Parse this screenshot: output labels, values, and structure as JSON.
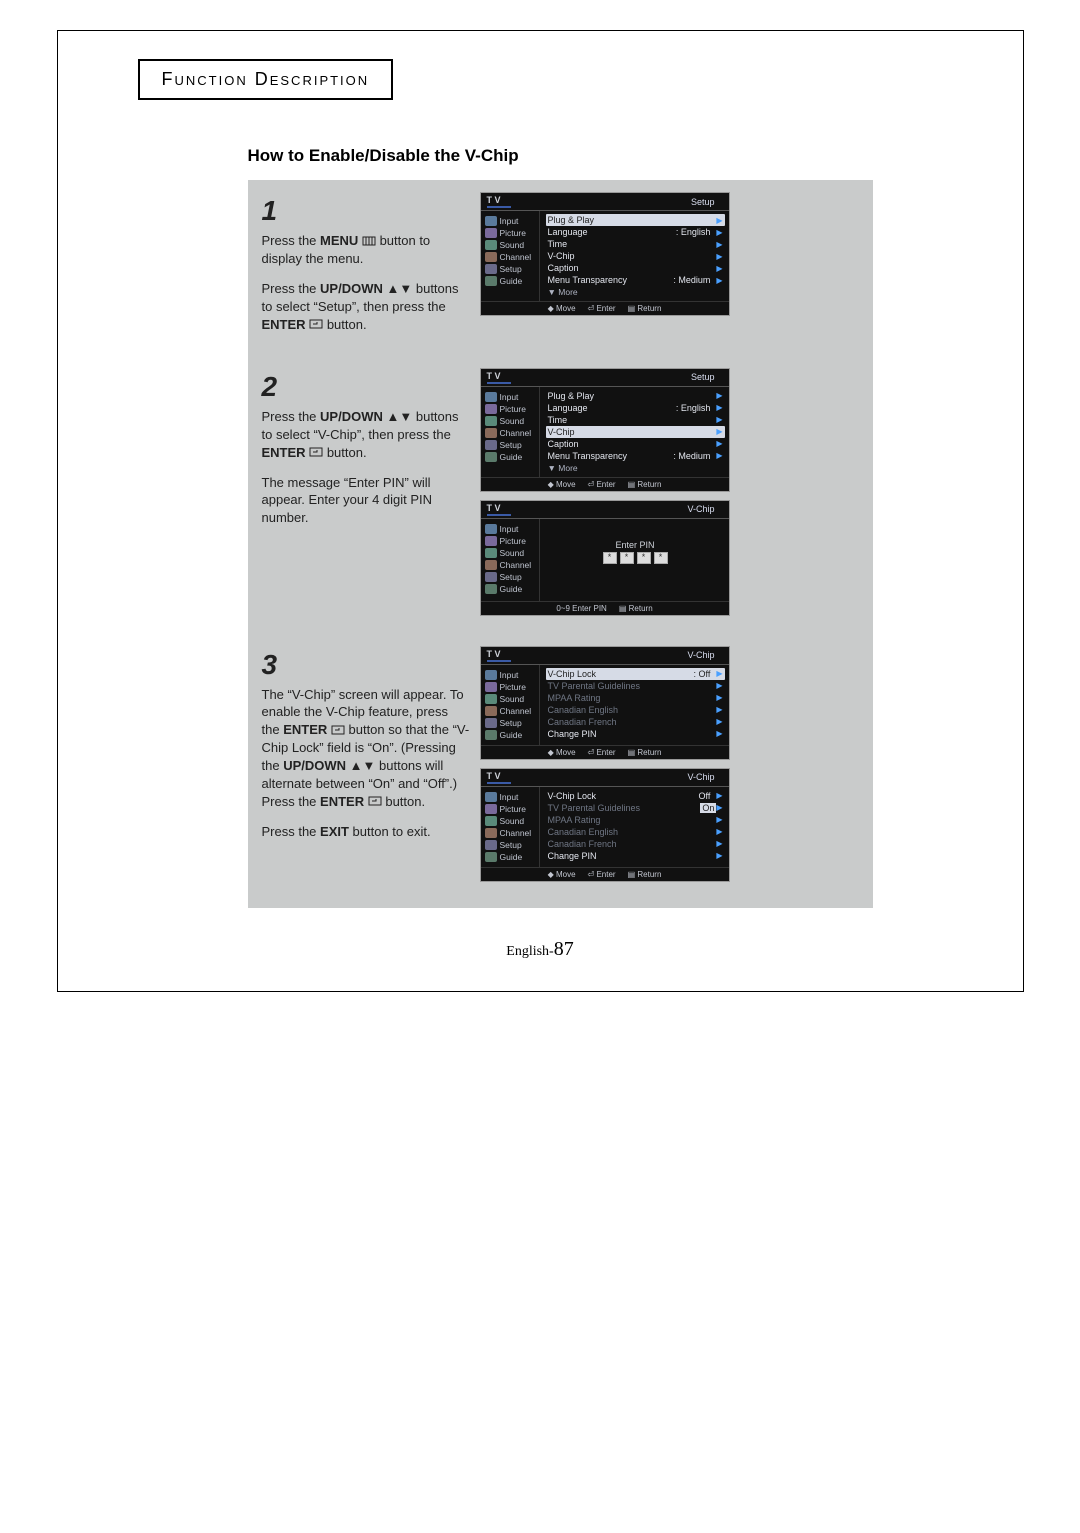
{
  "header": {
    "title": "Function Description"
  },
  "section": {
    "title": "How to Enable/Disable the V-Chip"
  },
  "page_label_prefix": "English-",
  "page_number": "87",
  "steps": [
    {
      "num": "1",
      "paras": [
        {
          "pre": "Press the ",
          "btn": "MENU",
          "icon": "menu",
          "post": " button to display the menu."
        },
        {
          "pre": "Press the ",
          "btn": "UP/DOWN",
          "icon": "updown",
          "post": " buttons to select “Setup”, then press the ",
          "btn2": "ENTER",
          "icon2": "enter",
          "post2": " button."
        }
      ]
    },
    {
      "num": "2",
      "paras": [
        {
          "pre": "Press the  ",
          "btn": "UP/DOWN",
          "icon": "updown",
          "post": " buttons  to select “V-Chip”, then press the ",
          "btn2": "ENTER",
          "icon2": "enter",
          "post2": " button."
        },
        {
          "pre": "The message “Enter PIN” will appear. Enter your 4 digit PIN number."
        }
      ]
    },
    {
      "num": "3",
      "paras": [
        {
          "pre": "The “V-Chip” screen will appear. To enable the V-Chip feature, press the ",
          "btn": "ENTER",
          "icon": "enter",
          "post": "  button so that the “V-Chip Lock” field is “On”.  (Pressing the ",
          "btn2": "UP/DOWN",
          "icon2": "updown",
          "post2": "  buttons will alternate  between “On” and “Off”.) Press the ",
          "btn3": "ENTER",
          "icon3": "enter",
          "post3": " button."
        },
        {
          "pre": "Press the ",
          "btn": "EXIT",
          "post": " button to exit."
        }
      ]
    }
  ],
  "tv": {
    "label": "T V",
    "side_items": [
      "Input",
      "Picture",
      "Sound",
      "Channel",
      "Setup",
      "Guide"
    ],
    "footer": {
      "move": "Move",
      "enter": "Enter",
      "ret": "Return",
      "pin_hint": "0~9 Enter PIN"
    },
    "screens": {
      "setup_main": {
        "title": "Setup",
        "rows": [
          {
            "label": "Plug & Play",
            "hl": true
          },
          {
            "label": "Language",
            "value": ": English"
          },
          {
            "label": "Time"
          },
          {
            "label": "V-Chip"
          },
          {
            "label": "Caption"
          },
          {
            "label": "Menu Transparency",
            "value": ": Medium"
          },
          {
            "label": "▼ More",
            "more": true
          }
        ]
      },
      "setup_vchip": {
        "title": "Setup",
        "rows": [
          {
            "label": "Plug & Play"
          },
          {
            "label": "Language",
            "value": ": English"
          },
          {
            "label": "Time"
          },
          {
            "label": "V-Chip",
            "hl": true
          },
          {
            "label": "Caption"
          },
          {
            "label": "Menu Transparency",
            "value": ": Medium"
          },
          {
            "label": "▼ More",
            "more": true
          }
        ]
      },
      "enter_pin": {
        "title": "V-Chip",
        "enter_pin_label": "Enter PIN",
        "cells": [
          "*",
          "*",
          "*",
          "*"
        ]
      },
      "vchip_off": {
        "title": "V-Chip",
        "rows": [
          {
            "label": "V-Chip Lock",
            "value": ": Off",
            "hl": true
          },
          {
            "label": "TV Parental Guidelines",
            "dim": true
          },
          {
            "label": "MPAA Rating",
            "dim": true
          },
          {
            "label": "Canadian English",
            "dim": true
          },
          {
            "label": "Canadian French",
            "dim": true
          },
          {
            "label": "Change PIN"
          }
        ]
      },
      "vchip_on": {
        "title": "V-Chip",
        "rows": [
          {
            "label": "V-Chip Lock",
            "value": "Off"
          },
          {
            "label": "TV Parental Guidelines",
            "value": "On",
            "dim": true,
            "on": true
          },
          {
            "label": "MPAA Rating",
            "dim": true
          },
          {
            "label": "Canadian English",
            "dim": true
          },
          {
            "label": "Canadian French",
            "dim": true
          },
          {
            "label": "Change PIN"
          }
        ]
      }
    }
  }
}
